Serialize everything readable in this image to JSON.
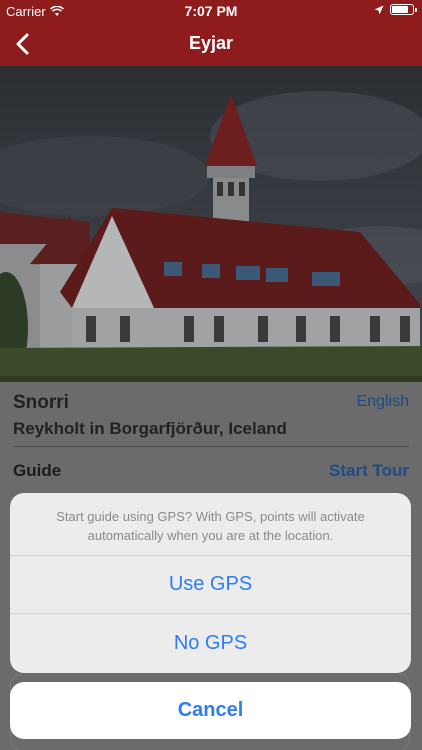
{
  "status_bar": {
    "carrier": "Carrier",
    "time": "7:07 PM",
    "battery_level": 0.85
  },
  "nav": {
    "title": "Eyjar",
    "back_icon": "chevron-left-icon"
  },
  "hero": {
    "description_icon": "church-photo"
  },
  "place": {
    "name": "Snorri",
    "language": "English",
    "location": "Reykholt in Borgarfjörður, Iceland"
  },
  "guide": {
    "label": "Guide",
    "start_tour": "Start Tour"
  },
  "action_sheet": {
    "message": "Start guide using GPS? With GPS, points will activate automatically when you are at the location.",
    "use_gps": "Use GPS",
    "no_gps": "No GPS",
    "cancel": "Cancel"
  },
  "colors": {
    "nav_red": "#8f1c1c",
    "ios_blue": "#2f7cf6",
    "link_blue_dimmed": "#1d4c86"
  }
}
